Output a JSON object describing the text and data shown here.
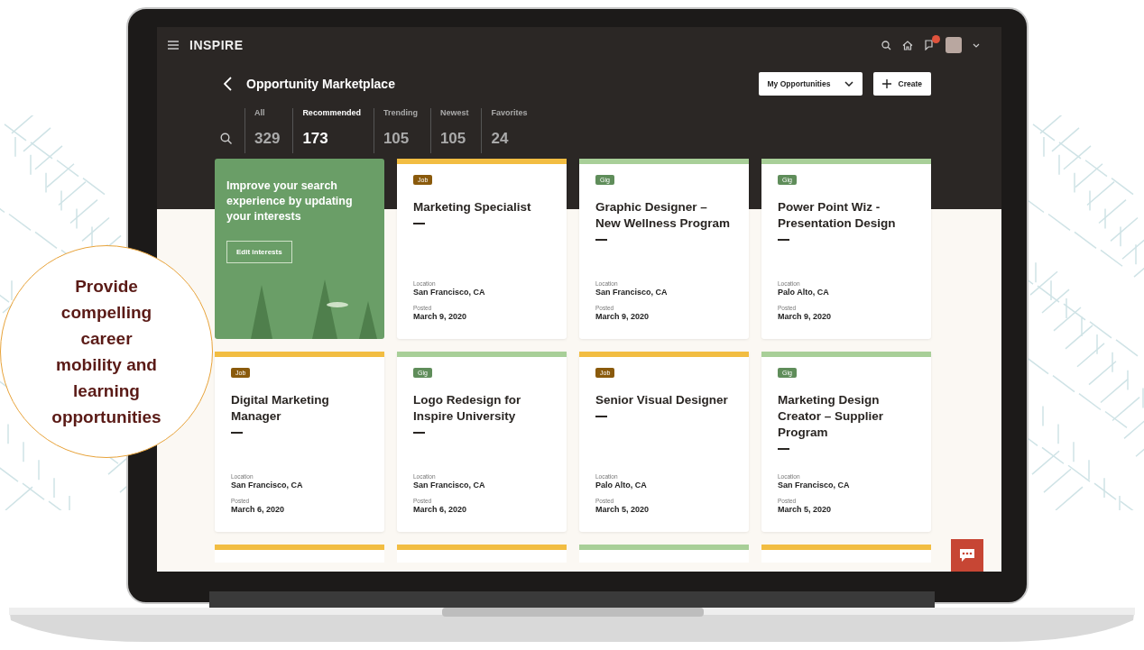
{
  "app": {
    "logo": "INSPIRE"
  },
  "header": {
    "title": "Opportunity Marketplace",
    "dropdown": "My Opportunities",
    "create_button": "Create"
  },
  "tabs": [
    {
      "label": "All",
      "count": "329",
      "selected": false
    },
    {
      "label": "Recommended",
      "count": "173",
      "selected": true
    },
    {
      "label": "Trending",
      "count": "105",
      "selected": false
    },
    {
      "label": "Newest",
      "count": "105",
      "selected": false
    },
    {
      "label": "Favorites",
      "count": "24",
      "selected": false
    }
  ],
  "cards": [
    {
      "kind": "promo",
      "text": "Improve your search experience by updating your interests",
      "button": "Edit interests"
    },
    {
      "kind": "opportunity",
      "color": "#f2bd42",
      "tag": {
        "label": "Job",
        "color": "#8a5a0c"
      },
      "title": "Marketing Specialist",
      "location_label": "Location",
      "location": "San Francisco, CA",
      "posted_label": "Posted",
      "posted": "March 9, 2020"
    },
    {
      "kind": "opportunity",
      "color": "#a8cf98",
      "tag": {
        "label": "Gig",
        "color": "#5f8d5a"
      },
      "title": "Graphic Designer – New Wellness Program",
      "location_label": "Location",
      "location": "San Francisco, CA",
      "posted_label": "Posted",
      "posted": "March 9, 2020"
    },
    {
      "kind": "opportunity",
      "color": "#a8cf98",
      "tag": {
        "label": "Gig",
        "color": "#5f8d5a"
      },
      "title": "Power Point Wiz - Presentation Design",
      "location_label": "Location",
      "location": "Palo Alto, CA",
      "posted_label": "Posted",
      "posted": "March 9, 2020"
    },
    {
      "kind": "opportunity",
      "color": "#f2bd42",
      "tag": {
        "label": "Job",
        "color": "#8a5a0c"
      },
      "title": "Digital Marketing Manager",
      "location_label": "Location",
      "location": "San Francisco, CA",
      "posted_label": "Posted",
      "posted": "March 6, 2020"
    },
    {
      "kind": "opportunity",
      "color": "#a8cf98",
      "tag": {
        "label": "Gig",
        "color": "#5f8d5a"
      },
      "title": "Logo Redesign for Inspire University",
      "location_label": "Location",
      "location": "San Francisco, CA",
      "posted_label": "Posted",
      "posted": "March 6, 2020"
    },
    {
      "kind": "opportunity",
      "color": "#f2bd42",
      "tag": {
        "label": "Job",
        "color": "#8a5a0c"
      },
      "title": "Senior Visual Designer",
      "location_label": "Location",
      "location": "Palo Alto, CA",
      "posted_label": "Posted",
      "posted": "March 5, 2020"
    },
    {
      "kind": "opportunity",
      "color": "#a8cf98",
      "tag": {
        "label": "Gig",
        "color": "#5f8d5a"
      },
      "title": "Marketing Design Creator – Supplier Program",
      "location_label": "Location",
      "location": "San Francisco, CA",
      "posted_label": "Posted",
      "posted": "March 5, 2020"
    }
  ],
  "more_cards": [
    {
      "color": "#f2bd42"
    },
    {
      "color": "#f2bd42"
    },
    {
      "color": "#a8cf98"
    },
    {
      "color": "#f2bd42"
    }
  ],
  "callout": {
    "text": "Provide compelling career mobility and learning opportunities"
  }
}
